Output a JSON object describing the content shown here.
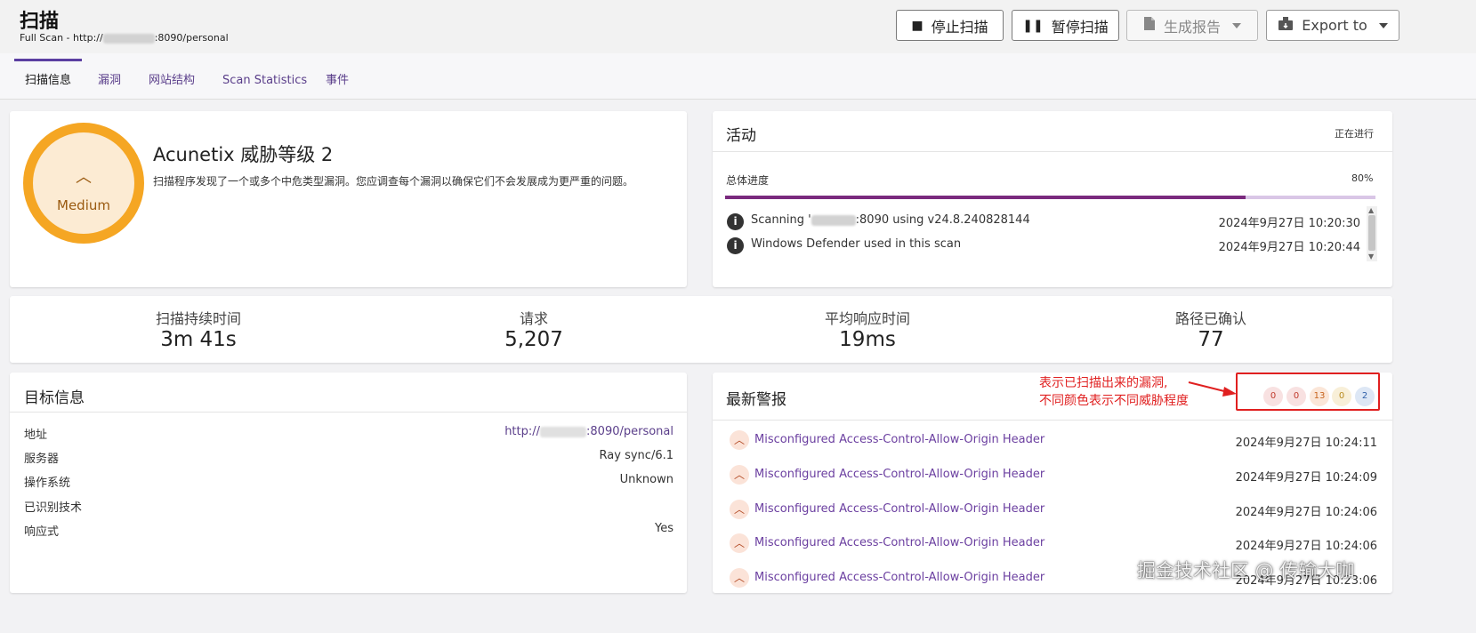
{
  "header": {
    "title": "扫描",
    "subtitle_prefix": "Full Scan - http://",
    "subtitle_suffix": ":8090/personal",
    "buttons": {
      "stop": "停止扫描",
      "pause": "暂停扫描",
      "report": "生成报告",
      "export": "Export to"
    }
  },
  "tabs": [
    "扫描信息",
    "漏洞",
    "网站结构",
    "Scan Statistics",
    "事件"
  ],
  "threat": {
    "ring_label": "Medium",
    "title": "Acunetix 威胁等级 2",
    "description": "扫描程序发现了一个或多个中危类型漏洞。您应调查每个漏洞以确保它们不会发展成为更严重的问题。"
  },
  "activity": {
    "title": "活动",
    "status": "正在进行",
    "progress_label": "总体进度",
    "progress_value": "80%",
    "progress_fraction": 0.8,
    "logs": [
      {
        "prefix": "Scanning '",
        "suffix": ":8090 using v24.8.240828144",
        "time": "2024年9月27日 10:20:30"
      },
      {
        "prefix": "Windows Defender used in this scan",
        "suffix": "",
        "time": "2024年9月27日 10:20:44"
      }
    ]
  },
  "stats": [
    {
      "label": "扫描持续时间",
      "value": "3m 41s"
    },
    {
      "label": "请求",
      "value": "5,207"
    },
    {
      "label": "平均响应时间",
      "value": "19ms"
    },
    {
      "label": "路径已确认",
      "value": "77"
    }
  ],
  "target": {
    "title": "目标信息",
    "rows": [
      {
        "label": "地址",
        "value_prefix": "http://",
        "value_suffix": ":8090/personal"
      },
      {
        "label": "服务器",
        "value": "Ray sync/6.1"
      },
      {
        "label": "操作系统",
        "value": "Unknown"
      },
      {
        "label": "已识别技术",
        "value": ""
      },
      {
        "label": "响应式",
        "value": "Yes"
      }
    ]
  },
  "alerts": {
    "title": "最新警报",
    "annotation_line1": "表示已扫描出来的漏洞,",
    "annotation_line2": "不同颜色表示不同威胁程度",
    "badges": [
      {
        "value": "0",
        "color": "#c0392b",
        "bg": "#f8e1e1"
      },
      {
        "value": "0",
        "color": "#c0392b",
        "bg": "#f8e1e1"
      },
      {
        "value": "13",
        "color": "#c8641e",
        "bg": "#fbe6d8"
      },
      {
        "value": "0",
        "color": "#b88a1e",
        "bg": "#f8efd8"
      },
      {
        "value": "2",
        "color": "#2e5fa8",
        "bg": "#dde7f5"
      }
    ],
    "items": [
      {
        "name": "Misconfigured Access-Control-Allow-Origin Header",
        "time": "2024年9月27日 10:24:11"
      },
      {
        "name": "Misconfigured Access-Control-Allow-Origin Header",
        "time": "2024年9月27日 10:24:09"
      },
      {
        "name": "Misconfigured Access-Control-Allow-Origin Header",
        "time": "2024年9月27日 10:24:06"
      },
      {
        "name": "Misconfigured Access-Control-Allow-Origin Header",
        "time": "2024年9月27日 10:24:06"
      },
      {
        "name": "Misconfigured Access-Control-Allow-Origin Header",
        "time": "2024年9月27日 10:23:06"
      }
    ]
  },
  "watermark": "掘金技术社区 @ 传输大咖",
  "colors": {
    "accent": "#5b3fa1",
    "threat_ring": "#f5a623",
    "progress": "#7a2a7e",
    "annotation": "#e02020"
  }
}
